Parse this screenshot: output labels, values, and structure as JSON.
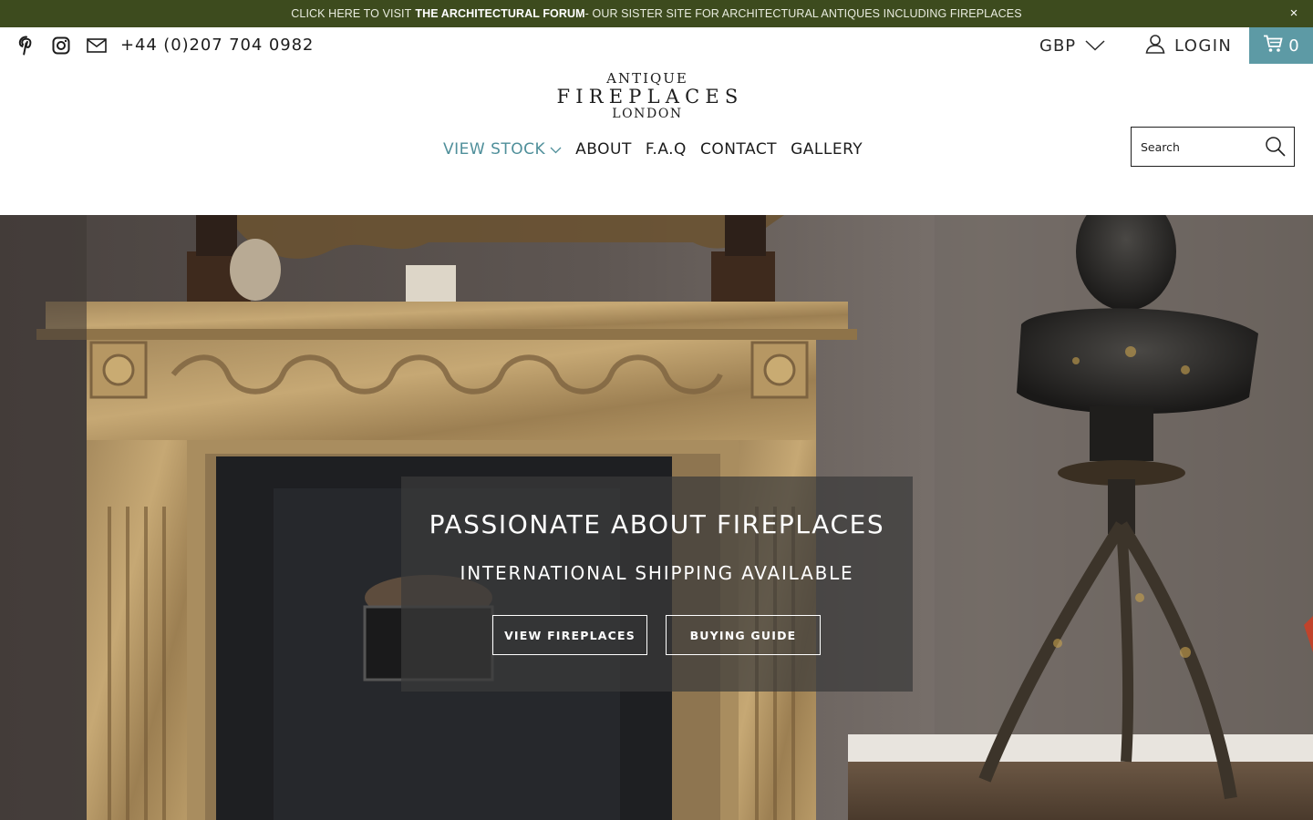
{
  "announcement": {
    "prefix": "CLICK HERE TO VISIT",
    "highlight": "THE ARCHITECTURAL FORUM",
    "suffix": "- OUR SISTER SITE FOR ARCHITECTURAL ANTIQUES INCLUDING FIREPLACES",
    "close_icon": "×"
  },
  "header": {
    "social_icons": [
      "pinterest-icon",
      "instagram-icon",
      "mail-icon"
    ],
    "phone": "+44 (0)207 704 0982",
    "currency": "GBP",
    "login_label": "LOGIN",
    "cart_count": "0"
  },
  "logo": {
    "line1": "ANTIQUE",
    "line2": "FIREPLACES",
    "line3": "LONDON"
  },
  "nav": {
    "items": [
      "VIEW STOCK",
      "ABOUT",
      "F.A.Q",
      "CONTACT",
      "GALLERY"
    ]
  },
  "search": {
    "placeholder": "Search"
  },
  "hero": {
    "title": "PASSIONATE ABOUT FIREPLACES",
    "subtitle": "INTERNATIONAL SHIPPING AVAILABLE",
    "button1": "VIEW FIREPLACES",
    "button2": "BUYING GUIDE"
  },
  "colors": {
    "announcement_bg": "#3d4b1e",
    "accent_teal": "#5d9aa5",
    "nav_active": "#4f8f9a"
  }
}
